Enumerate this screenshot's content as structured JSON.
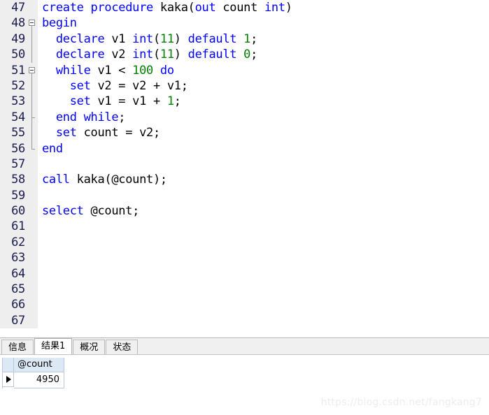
{
  "editor": {
    "language": "sql",
    "first_line_number": 47,
    "colors": {
      "keyword": "#0000ff",
      "number": "#008000",
      "plain": "#000000",
      "gutter_bg": "#eeeeee",
      "gutter_fg": "#1a1a4d",
      "editor_bg": "#ffffff"
    },
    "lines": [
      {
        "number": "47",
        "fold": "none",
        "tokens": [
          {
            "t": "create procedure ",
            "c": "kw"
          },
          {
            "t": "kaka(",
            "c": "pl"
          },
          {
            "t": "out",
            "c": "kw"
          },
          {
            "t": " count ",
            "c": "pl"
          },
          {
            "t": "int",
            "c": "kw"
          },
          {
            "t": ")",
            "c": "pl"
          }
        ]
      },
      {
        "number": "48",
        "fold": "open",
        "tokens": [
          {
            "t": "begin",
            "c": "kw"
          }
        ]
      },
      {
        "number": "49",
        "fold": "line",
        "tokens": [
          {
            "t": "  ",
            "c": "pl"
          },
          {
            "t": "declare",
            "c": "kw"
          },
          {
            "t": " v1 ",
            "c": "pl"
          },
          {
            "t": "int",
            "c": "kw"
          },
          {
            "t": "(",
            "c": "pl"
          },
          {
            "t": "11",
            "c": "num"
          },
          {
            "t": ") ",
            "c": "pl"
          },
          {
            "t": "default",
            "c": "kw"
          },
          {
            "t": " ",
            "c": "pl"
          },
          {
            "t": "1",
            "c": "num"
          },
          {
            "t": ";",
            "c": "pl"
          }
        ]
      },
      {
        "number": "50",
        "fold": "line",
        "tokens": [
          {
            "t": "  ",
            "c": "pl"
          },
          {
            "t": "declare",
            "c": "kw"
          },
          {
            "t": " v2 ",
            "c": "pl"
          },
          {
            "t": "int",
            "c": "kw"
          },
          {
            "t": "(",
            "c": "pl"
          },
          {
            "t": "11",
            "c": "num"
          },
          {
            "t": ") ",
            "c": "pl"
          },
          {
            "t": "default",
            "c": "kw"
          },
          {
            "t": " ",
            "c": "pl"
          },
          {
            "t": "0",
            "c": "num"
          },
          {
            "t": ";",
            "c": "pl"
          }
        ]
      },
      {
        "number": "51",
        "fold": "open-inner",
        "tokens": [
          {
            "t": "  ",
            "c": "pl"
          },
          {
            "t": "while",
            "c": "kw"
          },
          {
            "t": " v1 < ",
            "c": "pl"
          },
          {
            "t": "100",
            "c": "num"
          },
          {
            "t": " ",
            "c": "pl"
          },
          {
            "t": "do",
            "c": "kw"
          }
        ]
      },
      {
        "number": "52",
        "fold": "line-inner",
        "tokens": [
          {
            "t": "    ",
            "c": "pl"
          },
          {
            "t": "set",
            "c": "kw"
          },
          {
            "t": " v2 = v2 + v1;",
            "c": "pl"
          }
        ]
      },
      {
        "number": "53",
        "fold": "line-inner",
        "tokens": [
          {
            "t": "    ",
            "c": "pl"
          },
          {
            "t": "set",
            "c": "kw"
          },
          {
            "t": " v1 = v1 + ",
            "c": "pl"
          },
          {
            "t": "1",
            "c": "num"
          },
          {
            "t": ";",
            "c": "pl"
          }
        ]
      },
      {
        "number": "54",
        "fold": "end-inner",
        "tokens": [
          {
            "t": "  ",
            "c": "pl"
          },
          {
            "t": "end while",
            "c": "kw"
          },
          {
            "t": ";",
            "c": "pl"
          }
        ]
      },
      {
        "number": "55",
        "fold": "line",
        "tokens": [
          {
            "t": "  ",
            "c": "pl"
          },
          {
            "t": "set",
            "c": "kw"
          },
          {
            "t": " count = v2;",
            "c": "pl"
          }
        ]
      },
      {
        "number": "56",
        "fold": "end",
        "tokens": [
          {
            "t": "end",
            "c": "kw"
          }
        ]
      },
      {
        "number": "57",
        "fold": "none",
        "tokens": []
      },
      {
        "number": "58",
        "fold": "none",
        "tokens": [
          {
            "t": "call",
            "c": "kw"
          },
          {
            "t": " kaka(@count);",
            "c": "pl"
          }
        ]
      },
      {
        "number": "59",
        "fold": "none",
        "tokens": []
      },
      {
        "number": "60",
        "fold": "none",
        "tokens": [
          {
            "t": "select",
            "c": "kw"
          },
          {
            "t": " @count;",
            "c": "pl"
          }
        ]
      },
      {
        "number": "61",
        "fold": "none",
        "tokens": []
      },
      {
        "number": "62",
        "fold": "none",
        "tokens": []
      },
      {
        "number": "63",
        "fold": "none",
        "tokens": []
      },
      {
        "number": "64",
        "fold": "none",
        "tokens": []
      },
      {
        "number": "65",
        "fold": "none",
        "tokens": []
      },
      {
        "number": "66",
        "fold": "none",
        "tokens": []
      },
      {
        "number": "67",
        "fold": "none",
        "tokens": []
      }
    ]
  },
  "tabs": [
    {
      "label": "信息",
      "active": false
    },
    {
      "label": "结果1",
      "active": true
    },
    {
      "label": "概况",
      "active": false
    },
    {
      "label": "状态",
      "active": false
    }
  ],
  "results": {
    "columns": [
      "@count"
    ],
    "rows": [
      {
        "selected": true,
        "cells": [
          "4950"
        ]
      }
    ]
  },
  "watermark": {
    "text": "https://blog.csdn.net/fangkang7"
  }
}
